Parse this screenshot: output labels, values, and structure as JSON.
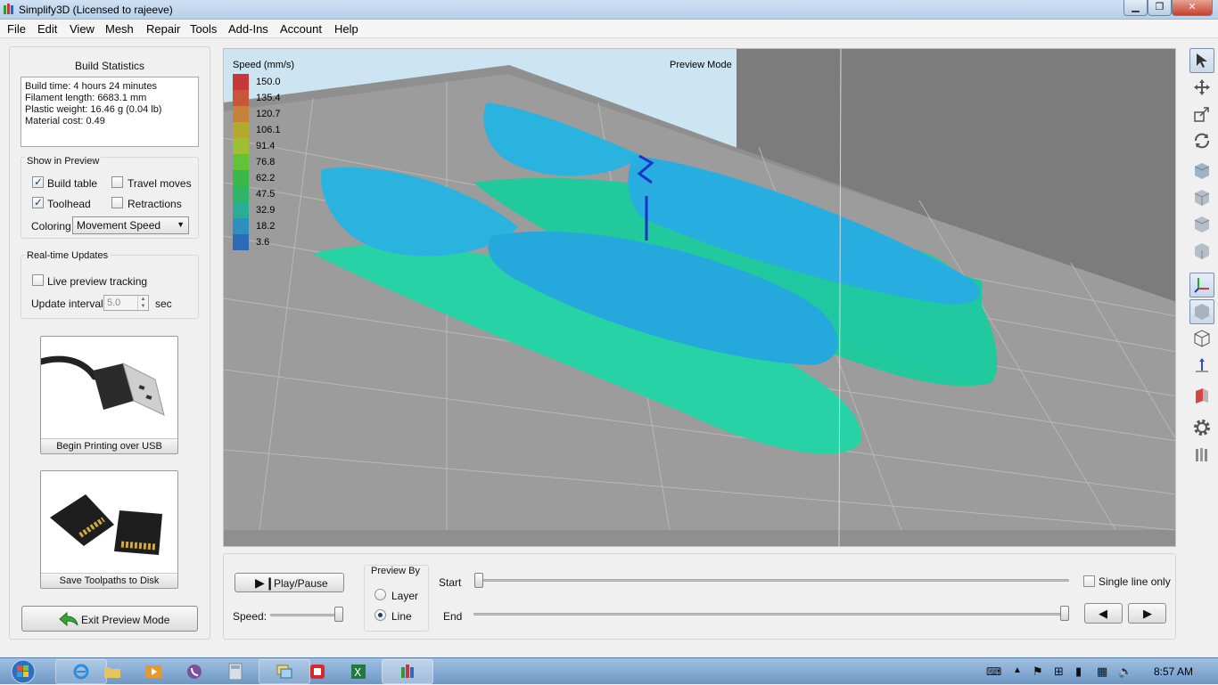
{
  "window": {
    "title": "Simplify3D (Licensed to rajeeve)"
  },
  "menu": [
    "File",
    "Edit",
    "View",
    "Mesh",
    "Repair",
    "Tools",
    "Add-Ins",
    "Account",
    "Help"
  ],
  "build_stats": {
    "title": "Build Statistics",
    "lines": [
      "Build time: 4 hours 24 minutes",
      "Filament length: 6683.1 mm",
      "Plastic weight: 16.46 g (0.04 lb)",
      "Material cost: 0.49"
    ]
  },
  "show_preview": {
    "title": "Show in Preview",
    "build_table": {
      "label": "Build table",
      "checked": true
    },
    "travel_moves": {
      "label": "Travel moves",
      "checked": false
    },
    "toolhead": {
      "label": "Toolhead",
      "checked": true
    },
    "retractions": {
      "label": "Retractions",
      "checked": false
    },
    "coloring_label": "Coloring",
    "coloring_value": "Movement Speed"
  },
  "realtime": {
    "title": "Real-time Updates",
    "live_label": "Live preview tracking",
    "live_checked": false,
    "interval_label": "Update interval",
    "interval_value": "5.0",
    "interval_unit": "sec"
  },
  "actions": {
    "usb_label": "Begin Printing over USB",
    "disk_label": "Save Toolpaths to Disk",
    "exit_label": "Exit Preview Mode"
  },
  "viewport": {
    "legend_title": "Speed (mm/s)",
    "mode_label": "Preview Mode",
    "legend": [
      {
        "value": "150.0",
        "color": "#c8383a"
      },
      {
        "value": "135.4",
        "color": "#c8573a"
      },
      {
        "value": "120.7",
        "color": "#c8813a"
      },
      {
        "value": "106.1",
        "color": "#b3aa2d"
      },
      {
        "value": "91.4",
        "color": "#9dc032"
      },
      {
        "value": "76.8",
        "color": "#62c238"
      },
      {
        "value": "62.2",
        "color": "#3bb84a"
      },
      {
        "value": "47.5",
        "color": "#2fb469"
      },
      {
        "value": "32.9",
        "color": "#2aac97"
      },
      {
        "value": "18.2",
        "color": "#2f8fbf"
      },
      {
        "value": "3.6",
        "color": "#2f6ab8"
      }
    ]
  },
  "playback": {
    "play_label": "Play/Pause",
    "speed_label": "Speed:",
    "preview_by_title": "Preview By",
    "layer_label": "Layer",
    "line_label": "Line",
    "preview_by_value": "Line",
    "start_label": "Start",
    "end_label": "End",
    "start_position": 0,
    "end_position": 1,
    "speed_position": 1,
    "single_line_label": "Single line only",
    "single_line_checked": false
  },
  "taskbar": {
    "clock": "8:57 AM"
  }
}
